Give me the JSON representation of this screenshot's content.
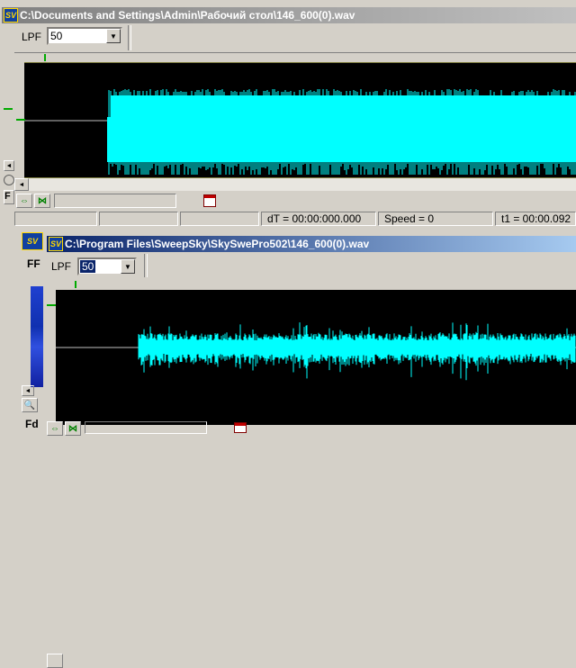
{
  "window1": {
    "title": "C:\\Documents and Settings\\Admin\\Рабочий стол\\146_600(0).wav",
    "icon_label": "SV",
    "lpf_label": "LPF",
    "lpf_value": "50",
    "status": {
      "dt": "dT = 00:00:000.000",
      "speed": "Speed = 0",
      "t1": "t1 = 00:00.092"
    }
  },
  "window2": {
    "title": "C:\\Program Files\\SweepSky\\SkySwePro502\\146_600(0).wav",
    "icon_label": "SV",
    "lpf_label": "LPF",
    "lpf_value": "50"
  },
  "background_window": {
    "icon_label": "SV",
    "fft_label": "FF",
    "fd_label": "Fd"
  },
  "colors": {
    "waveform": "#00ffff",
    "center_line": "#c0c0c0",
    "marker": "#00aa00",
    "active_title": "#0a246a",
    "inactive_title": "#808080"
  },
  "icons": [
    "expand-arrows-icon",
    "collapse-arrows-icon",
    "calendar-icon",
    "zoom-icon",
    "chevron-down-icon",
    "scroll-left-icon"
  ]
}
